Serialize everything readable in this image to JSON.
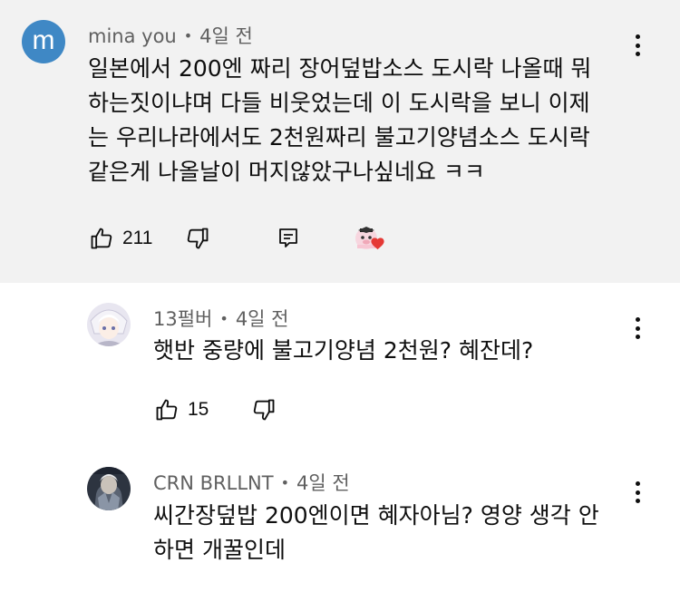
{
  "comments": [
    {
      "author": "mina you",
      "avatar_letter": "m",
      "time": "4일 전",
      "text_lines": [
        "일본에서 200엔 짜리 장어덮밥소스 도시락 나올때 뭐",
        "하는짓이냐며 다들 비웃었는데 이 도시락을 보니 이제",
        "는 우리나라에서도 2천원짜리 불고기양념소스 도시락",
        "같은게 나올날이 머지않았구나싶네요 ㅋㅋ"
      ],
      "likes": "211"
    },
    {
      "author": "13펄버",
      "time": "4일 전",
      "text_lines": [
        "햇반 중량에 불고기양념 2천원? 혜잔데?"
      ],
      "likes": "15"
    },
    {
      "author": "CRN BRLLNT",
      "time": "4일 전",
      "text_lines": [
        "씨간장덮밥 200엔이면 혜자아님? 영양 생각 안",
        "하면 개꿀인데"
      ]
    }
  ],
  "separator": "•",
  "icons": {
    "like": "thumbs-up-icon",
    "dislike": "thumbs-down-icon",
    "reply": "reply-comment-icon",
    "more": "more-vert-icon",
    "creator_heart": "creator-heart-icon"
  },
  "colors": {
    "main_bg": "#f2f2f2",
    "avatar_m": "#3f88c5",
    "heart": "#e53935",
    "meta_text": "#606060"
  }
}
